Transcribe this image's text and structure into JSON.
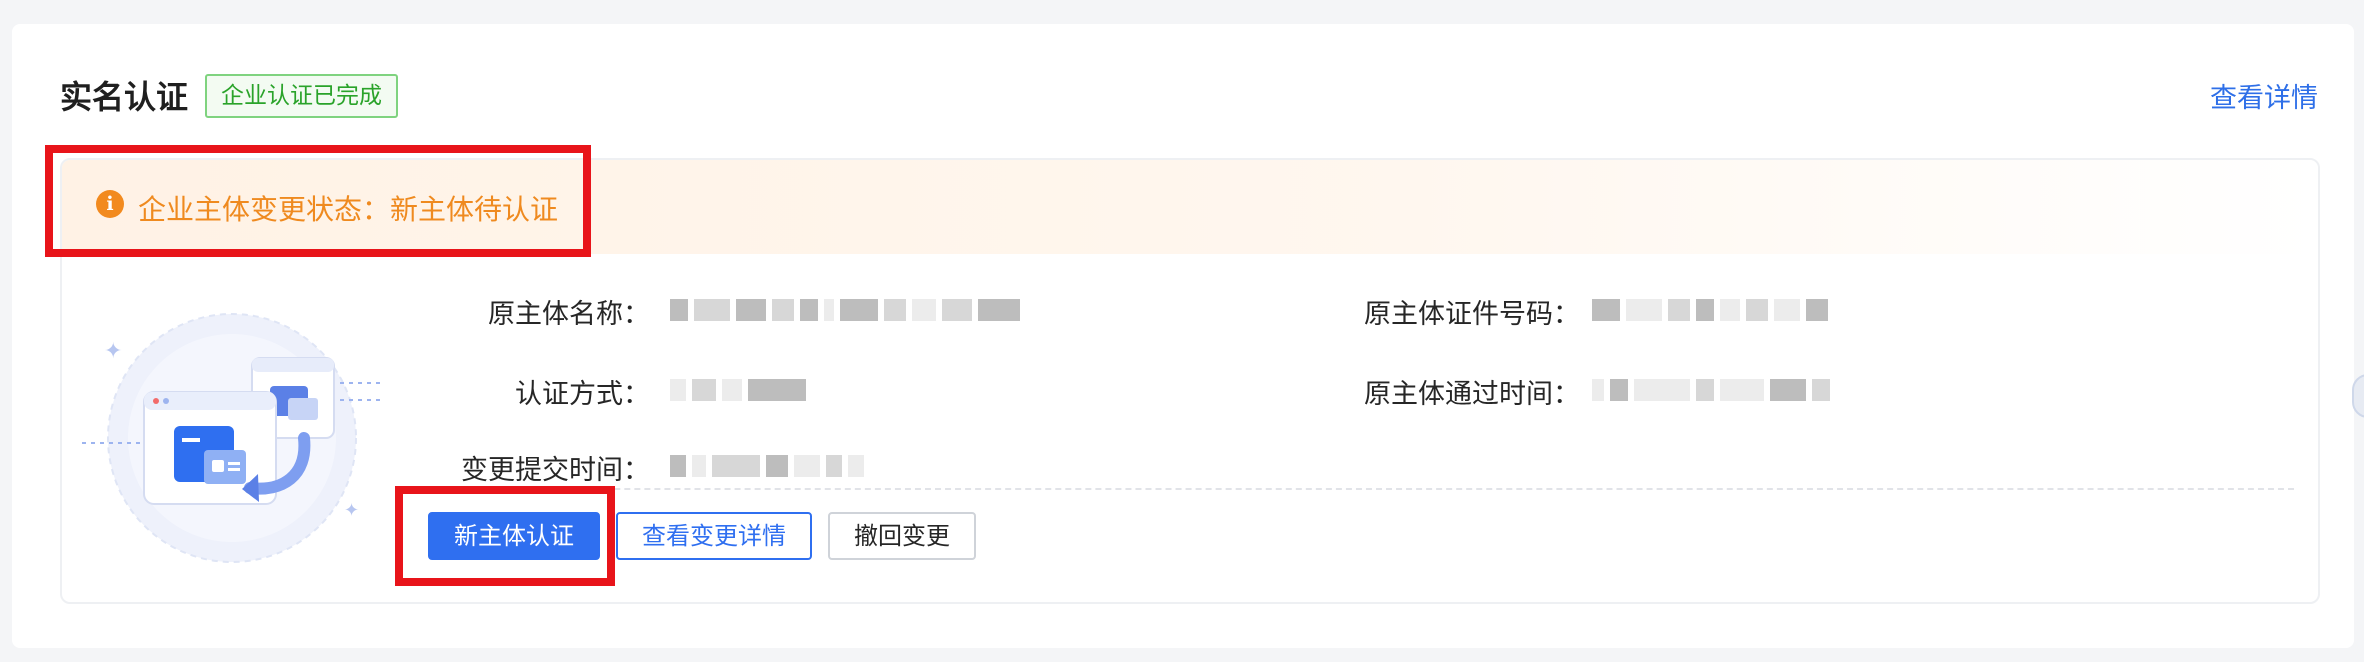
{
  "section": {
    "title": "实名认证",
    "badge": "企业认证已完成",
    "details_link": "查看详情"
  },
  "alert": {
    "icon": "info-icon",
    "text": "企业主体变更状态：新主体待认证"
  },
  "fields": {
    "original_name_label": "原主体名称：",
    "original_cert_label": "原主体证件号码：",
    "auth_method_label": "认证方式：",
    "original_pass_time_label": "原主体通过时间：",
    "change_submit_time_label": "变更提交时间："
  },
  "actions": {
    "new_auth": "新主体认证",
    "view_change": "查看变更详情",
    "withdraw": "撤回变更"
  },
  "colors": {
    "primary": "#2f6ff0",
    "warning": "#ef8a1f",
    "success": "#2aa32a",
    "highlight": "#e8141a"
  }
}
